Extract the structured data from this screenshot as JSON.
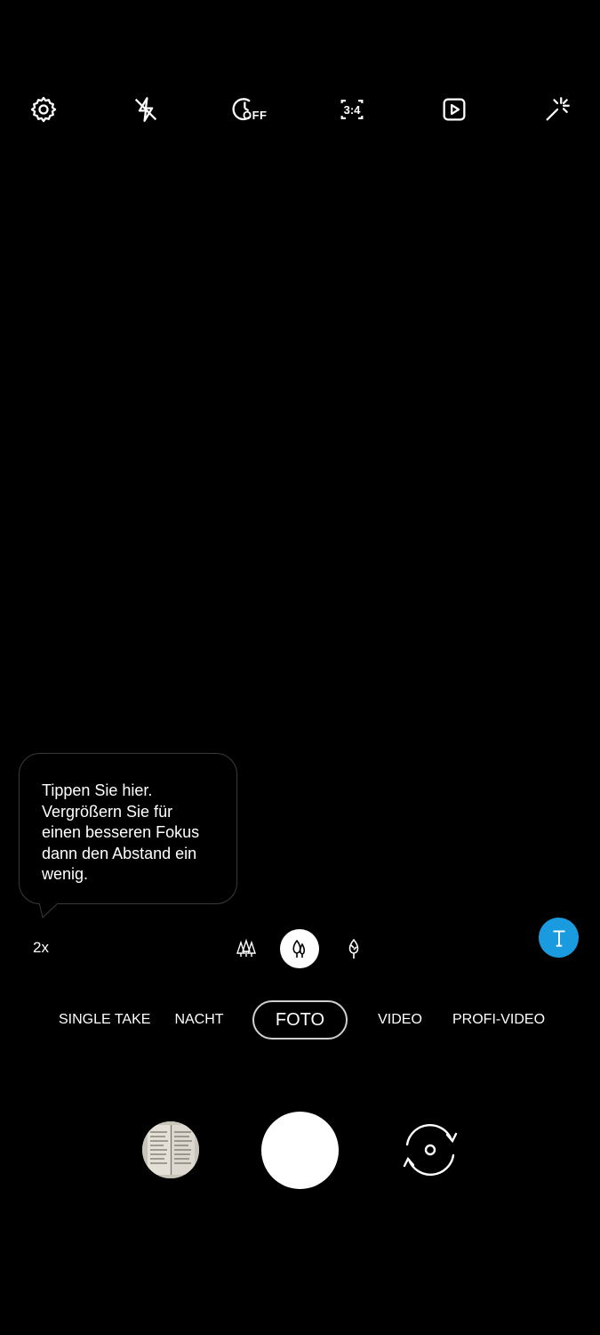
{
  "toolbar": {
    "settings_icon": "gear-icon",
    "flash_icon": "flash-off-icon",
    "timer_label": "OFF",
    "ratio_label": "3:4",
    "motion_photo_icon": "motion-photo-icon",
    "filters_icon": "magic-wand-icon"
  },
  "tooltip": {
    "text_line1": "Tippen Sie hier.",
    "text_line2": "Vergrößern Sie für",
    "text_line3": "einen besseren Fokus",
    "text_line4": "dann den Abstand ein",
    "text_line5": "wenig."
  },
  "zoom": {
    "label": "2x"
  },
  "lenses": {
    "wide_icon": "three-trees-icon",
    "standard_icon": "two-trees-icon",
    "tele_icon": "single-tree-icon",
    "active": "standard"
  },
  "scan": {
    "icon": "text-scan-icon",
    "color": "#1a9be0"
  },
  "modes": [
    {
      "label": "SINGLE TAKE"
    },
    {
      "label": "NACHT"
    },
    {
      "label": "FOTO"
    },
    {
      "label": "VIDEO"
    },
    {
      "label": "PROFI-VIDEO"
    }
  ],
  "active_mode": "FOTO",
  "bottom": {
    "gallery_thumbnail": "gallery-thumbnail",
    "shutter": "shutter-button",
    "switch_camera": "switch-camera-icon"
  }
}
